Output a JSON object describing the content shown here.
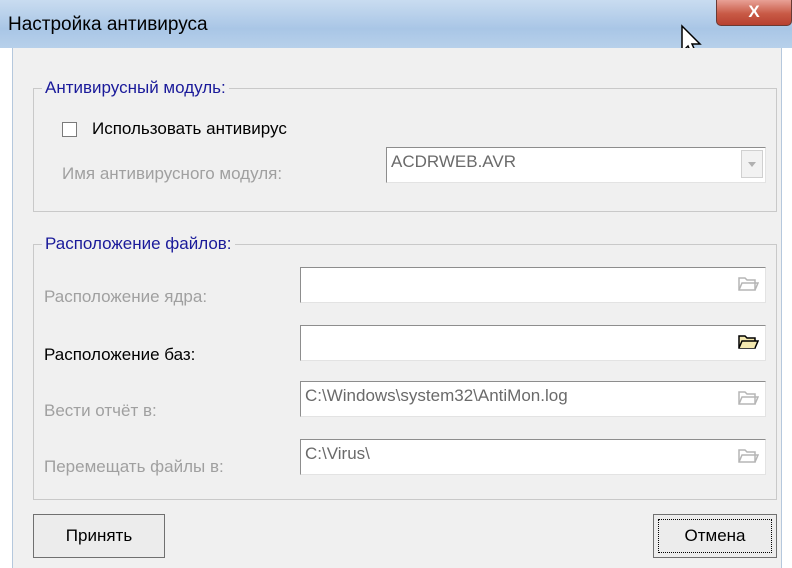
{
  "window": {
    "title": "Настройка антивируса",
    "close_label": "X"
  },
  "antivirus_group": {
    "legend": "Антивирусный модуль:",
    "use_antivirus_label": "Использовать антивирус",
    "use_antivirus_checked": false,
    "module_name_label": "Имя антивирусного модуля:",
    "module_name_value": "ACDRWEB.AVR"
  },
  "files_group": {
    "legend": "Расположение файлов:",
    "core_location_label": "Расположение ядра:",
    "core_location_value": "",
    "db_location_label": "Расположение баз:",
    "db_location_value": "",
    "report_label": "Вести отчёт в:",
    "report_value": "C:\\Windows\\system32\\AntiMon.log",
    "move_files_label": "Перемещать файлы в:",
    "move_files_value": "C:\\Virus\\"
  },
  "buttons": {
    "accept": "Принять",
    "cancel": "Отмена"
  }
}
